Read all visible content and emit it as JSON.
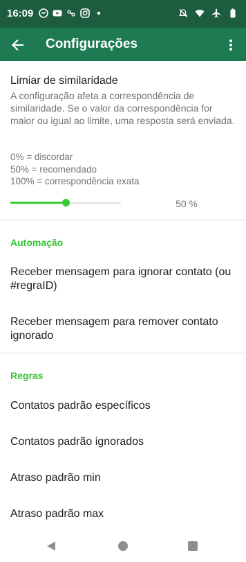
{
  "status_bar": {
    "time": "16:09",
    "left_icons": [
      "messenger-icon",
      "youtube-icon",
      "network-icon",
      "instagram-icon",
      "dot-icon"
    ],
    "right_icons": [
      "mute-icon",
      "wifi-icon",
      "airplane-icon",
      "battery-icon"
    ]
  },
  "app_bar": {
    "title": "Configurações",
    "back_icon": "arrow-left-icon",
    "menu_icon": "more-vert-icon"
  },
  "similarity": {
    "title": "Limiar de similaridade",
    "description": "A configuração afeta a correspondência de similaridade. Se o valor da correspondência for maior ou igual ao limite, uma resposta será enviada.",
    "legend": [
      "0% = discordar",
      "50% = recomendado",
      "100% = correspondência exata"
    ],
    "slider_value_percent": 50,
    "slider_label": "50 %"
  },
  "automation": {
    "header": "Automação",
    "items": [
      {
        "label": "Receber mensagem para ignorar contato (ou #regraID)"
      },
      {
        "label": "Receber mensagem para remover contato ignorado"
      }
    ]
  },
  "rules": {
    "header": "Regras",
    "items": [
      {
        "label": "Contatos padrão específicos"
      },
      {
        "label": "Contatos padrão ignorados"
      },
      {
        "label": "Atraso padrão min"
      },
      {
        "label": "Atraso padrão max"
      }
    ]
  },
  "colors": {
    "status_bar": "#1d5c3f",
    "app_bar": "#1d7a52",
    "accent": "#35c235"
  }
}
